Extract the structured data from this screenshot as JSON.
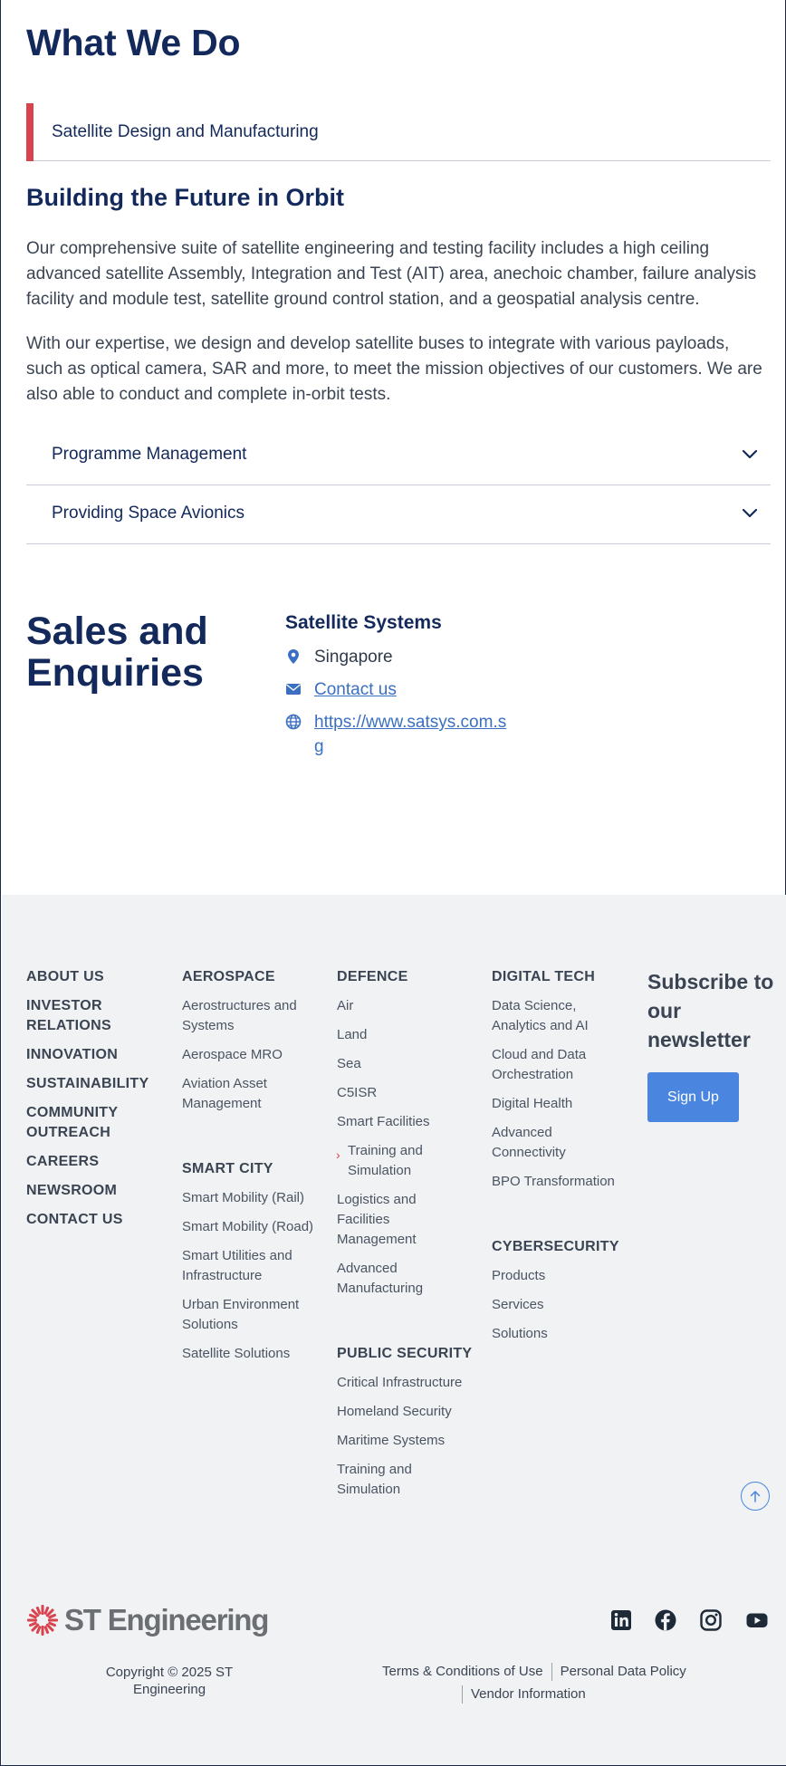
{
  "what_we_do": {
    "heading": "What We Do",
    "active_tab": "Satellite Design and Manufacturing",
    "section_title": "Building the Future in Orbit",
    "paragraphs": [
      "Our comprehensive suite of satellite engineering and testing facility includes a high ceiling advanced satellite Assembly, Integration and Test (AIT) area, anechoic chamber, failure analysis facility and module test, satellite ground control station, and a geospatial analysis centre.",
      "With our expertise, we design and develop satellite buses to integrate with various payloads, such as optical camera, SAR and more, to meet the mission objectives of our customers. We are also able to conduct and complete in-orbit tests."
    ],
    "accordions": [
      "Programme Management",
      "Providing Space Avionics"
    ]
  },
  "sales": {
    "heading": "Sales and Enquiries",
    "company": "Satellite Systems",
    "location": "Singapore",
    "contact_link": "Contact us",
    "website": "https://www.satsys.com.sg"
  },
  "footer": {
    "about_links": [
      "ABOUT US",
      "INVESTOR RELATIONS",
      "INNOVATION",
      "SUSTAINABILITY",
      "COMMUNITY OUTREACH",
      "CAREERS",
      "NEWSROOM",
      "CONTACT US"
    ],
    "aerospace": {
      "title": "AEROSPACE",
      "links": [
        "Aerostructures and Systems",
        "Aerospace MRO",
        "Aviation Asset Management"
      ]
    },
    "smart_city": {
      "title": "SMART CITY",
      "links": [
        "Smart Mobility (Rail)",
        "Smart Mobility (Road)",
        "Smart Utilities and Infrastructure",
        "Urban Environment Solutions",
        "Satellite Solutions"
      ]
    },
    "defence": {
      "title": "DEFENCE",
      "links": [
        "Air",
        "Land",
        "Sea",
        "C5ISR",
        "Smart Facilities",
        "Training and Simulation",
        "Logistics and Facilities Management",
        "Advanced Manufacturing"
      ]
    },
    "public_security": {
      "title": "PUBLIC SECURITY",
      "links": [
        "Critical Infrastructure",
        "Homeland Security",
        "Maritime Systems",
        "Training and Simulation"
      ]
    },
    "digital_tech": {
      "title": "DIGITAL TECH",
      "links": [
        "Data Science, Analytics and AI",
        "Cloud and Data Orchestration",
        "Digital Health",
        "Advanced Connectivity",
        "BPO Transformation"
      ]
    },
    "cybersecurity": {
      "title": "CYBERSECURITY",
      "links": [
        "Products",
        "Services",
        "Solutions"
      ]
    },
    "newsletter": {
      "title": "Subscribe to our newsletter",
      "button": "Sign Up"
    },
    "logo_text": "ST Engineering",
    "copyright": "Copyright © 2025 ST Engineering",
    "legal": {
      "terms": "Terms & Conditions of Use",
      "privacy": "Personal Data Policy",
      "vendor": "Vendor Information"
    },
    "social_icons": [
      "linkedin-icon",
      "facebook-icon",
      "instagram-icon",
      "youtube-icon"
    ],
    "colors": {
      "accent_red": "#d9434f",
      "navy": "#13295b",
      "button_blue": "#4a86e0",
      "footer_bg": "#f1f2f4"
    }
  }
}
